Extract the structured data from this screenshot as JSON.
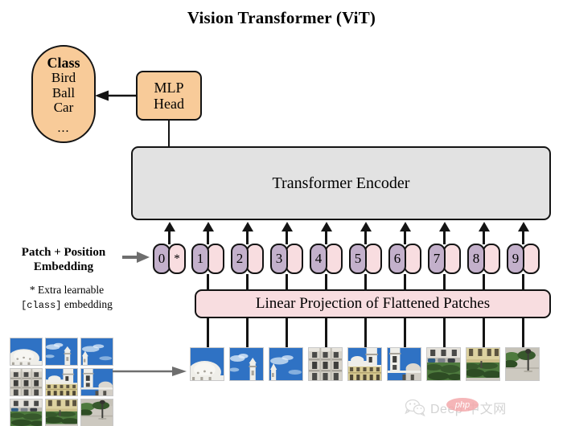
{
  "title": "Vision Transformer (ViT)",
  "class_box": {
    "name": "Class",
    "items": [
      "Bird",
      "Ball",
      "Car"
    ],
    "ellipsis": "...",
    "color": "#f8cb99"
  },
  "mlp_head": {
    "line1": "MLP",
    "line2": "Head",
    "color": "#f8cb99"
  },
  "encoder": {
    "label": "Transformer Encoder",
    "color": "#e2e2e2"
  },
  "linear_projection": {
    "label": "Linear Projection of Flattened Patches",
    "color": "#f8dde0"
  },
  "labels": {
    "patch_position_line1": "Patch + Position",
    "patch_position_line2": "Embedding",
    "extra_prefix": "* Extra learnable",
    "extra_mono": "[class]",
    "extra_suffix": "embedding"
  },
  "tokens": [
    {
      "index": "0",
      "marker": "*"
    },
    {
      "index": "1",
      "marker": ""
    },
    {
      "index": "2",
      "marker": ""
    },
    {
      "index": "3",
      "marker": ""
    },
    {
      "index": "4",
      "marker": ""
    },
    {
      "index": "5",
      "marker": ""
    },
    {
      "index": "6",
      "marker": ""
    },
    {
      "index": "7",
      "marker": ""
    },
    {
      "index": "8",
      "marker": ""
    },
    {
      "index": "9",
      "marker": ""
    }
  ],
  "token_colors": {
    "position_half": "#c3b0cb",
    "patch_half": "#f8dde0"
  },
  "patches": {
    "description": "3x3 grid of image patches of a baroque palace: sky on top row, building facade in middle row, garden and pavement in bottom row",
    "count": 9,
    "tiles": [
      {
        "id": "p1",
        "content": "white dome against blue sky"
      },
      {
        "id": "p2",
        "content": "blue sky with clouds and bell tower"
      },
      {
        "id": "p3",
        "content": "blue sky with clouds and tower edge"
      },
      {
        "id": "p4",
        "content": "grey stone facade with windows"
      },
      {
        "id": "p5",
        "content": "cream building with bell tower"
      },
      {
        "id": "p6",
        "content": "white tower and dome against sky"
      },
      {
        "id": "p7",
        "content": "building base with cars and hedge"
      },
      {
        "id": "p8",
        "content": "cream building with green hedges"
      },
      {
        "id": "p9",
        "content": "pavement with trees and lamppost"
      }
    ]
  },
  "watermark": {
    "text": "Deep  中文网",
    "badge": "php"
  },
  "colors": {
    "stroke": "#141414",
    "grey_arrow": "#6e6e6e",
    "sky": "#2f72c4",
    "stone": "#d8d4cb",
    "cream": "#d8cb92",
    "grass": "#4e7a3e",
    "pavement": "#cdc9c0"
  }
}
